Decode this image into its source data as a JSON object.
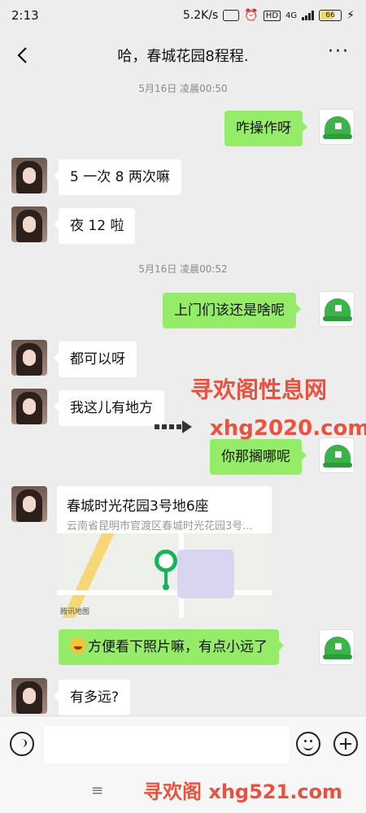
{
  "status": {
    "time": "2:13",
    "speed": "5.2K/s",
    "hd": "HD",
    "network": "4G",
    "battery": "66",
    "battery_level": 0.66
  },
  "header": {
    "title": "哈，春城花园8程程.",
    "back_icon": "chevron-left-icon",
    "more_icon": "more-icon",
    "more_label": "···"
  },
  "messages": {
    "ts1": "5月16日 凌晨00:50",
    "m1": "咋操作呀",
    "m2": "5 一次 8 两次嘛",
    "m3": "夜 12 啦",
    "ts2": "5月16日 凌晨00:52",
    "m4": "上门们该还是啥呢",
    "m5": "都可以呀",
    "m6": "我这儿有地方",
    "m7": "你那搁哪呢",
    "location": {
      "title": "春城时光花园3号地6座",
      "address": "云南省昆明市官渡区春城时光花园3号...",
      "map_source": "腾讯地图"
    },
    "m8": "方便看下照片嘛，有点小远了",
    "m9": "有多远?"
  },
  "watermarks": {
    "site_name": "寻欢阁性息网",
    "site_url": "xhg2020.com",
    "footer": "寻欢阁 xhg521.com"
  },
  "input_bar": {
    "voice_icon": "voice-icon",
    "emoji_icon": "smile-icon",
    "plus_icon": "plus-icon"
  },
  "bottom": {
    "menu_label": "≡"
  },
  "colors": {
    "chat_bg": "#ededed",
    "bubble_self": "#95ec69",
    "bubble_other": "#ffffff",
    "watermark": "#e8523f"
  }
}
